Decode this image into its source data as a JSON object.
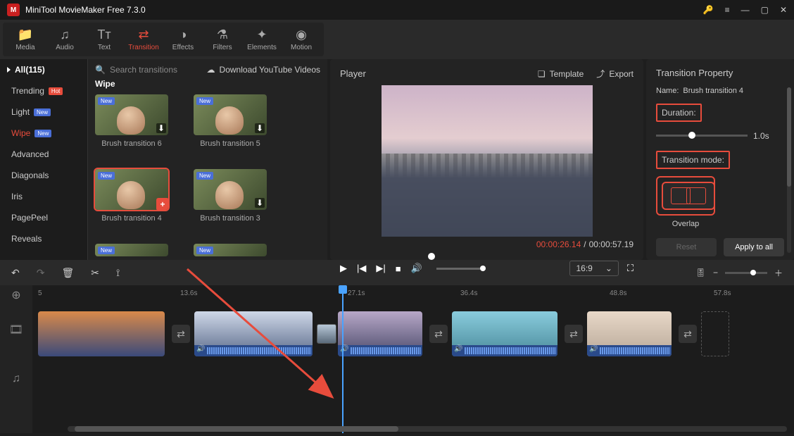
{
  "app": {
    "title": "MiniTool MovieMaker Free 7.3.0"
  },
  "tools": {
    "media": "Media",
    "audio": "Audio",
    "text": "Text",
    "transition": "Transition",
    "effects": "Effects",
    "filters": "Filters",
    "elements": "Elements",
    "motion": "Motion"
  },
  "sidebar": {
    "header": "All(115)",
    "items": [
      {
        "label": "Trending",
        "badge": "Hot",
        "badgeClass": "hot"
      },
      {
        "label": "Light",
        "badge": "New",
        "badgeClass": "new"
      },
      {
        "label": "Wipe",
        "badge": "New",
        "badgeClass": "new",
        "active": true
      },
      {
        "label": "Advanced"
      },
      {
        "label": "Diagonals"
      },
      {
        "label": "Iris"
      },
      {
        "label": "PagePeel"
      },
      {
        "label": "Reveals"
      }
    ]
  },
  "gallery": {
    "searchPlaceholder": "Search transitions",
    "downloadLink": "Download YouTube Videos",
    "category": "Wipe",
    "thumbs": [
      {
        "label": "Brush transition 6"
      },
      {
        "label": "Brush transition 5"
      },
      {
        "label": "Brush transition 4",
        "selected": true,
        "add": true
      },
      {
        "label": "Brush transition 3"
      }
    ]
  },
  "player": {
    "title": "Player",
    "template": "Template",
    "export": "Export",
    "current": "00:00:26.14",
    "total": "00:00:57.19",
    "ratio": "16:9"
  },
  "prop": {
    "title": "Transition Property",
    "nameLabel": "Name:",
    "nameValue": "Brush transition 4",
    "durationLabel": "Duration:",
    "durationValue": "1.0s",
    "modeLabel": "Transition mode:",
    "modeValue": "Overlap",
    "reset": "Reset",
    "apply": "Apply to all"
  },
  "timeline": {
    "marks": [
      "5",
      "13.6s",
      "27.1s",
      "36.4s",
      "48.8s",
      "57.8s"
    ]
  }
}
